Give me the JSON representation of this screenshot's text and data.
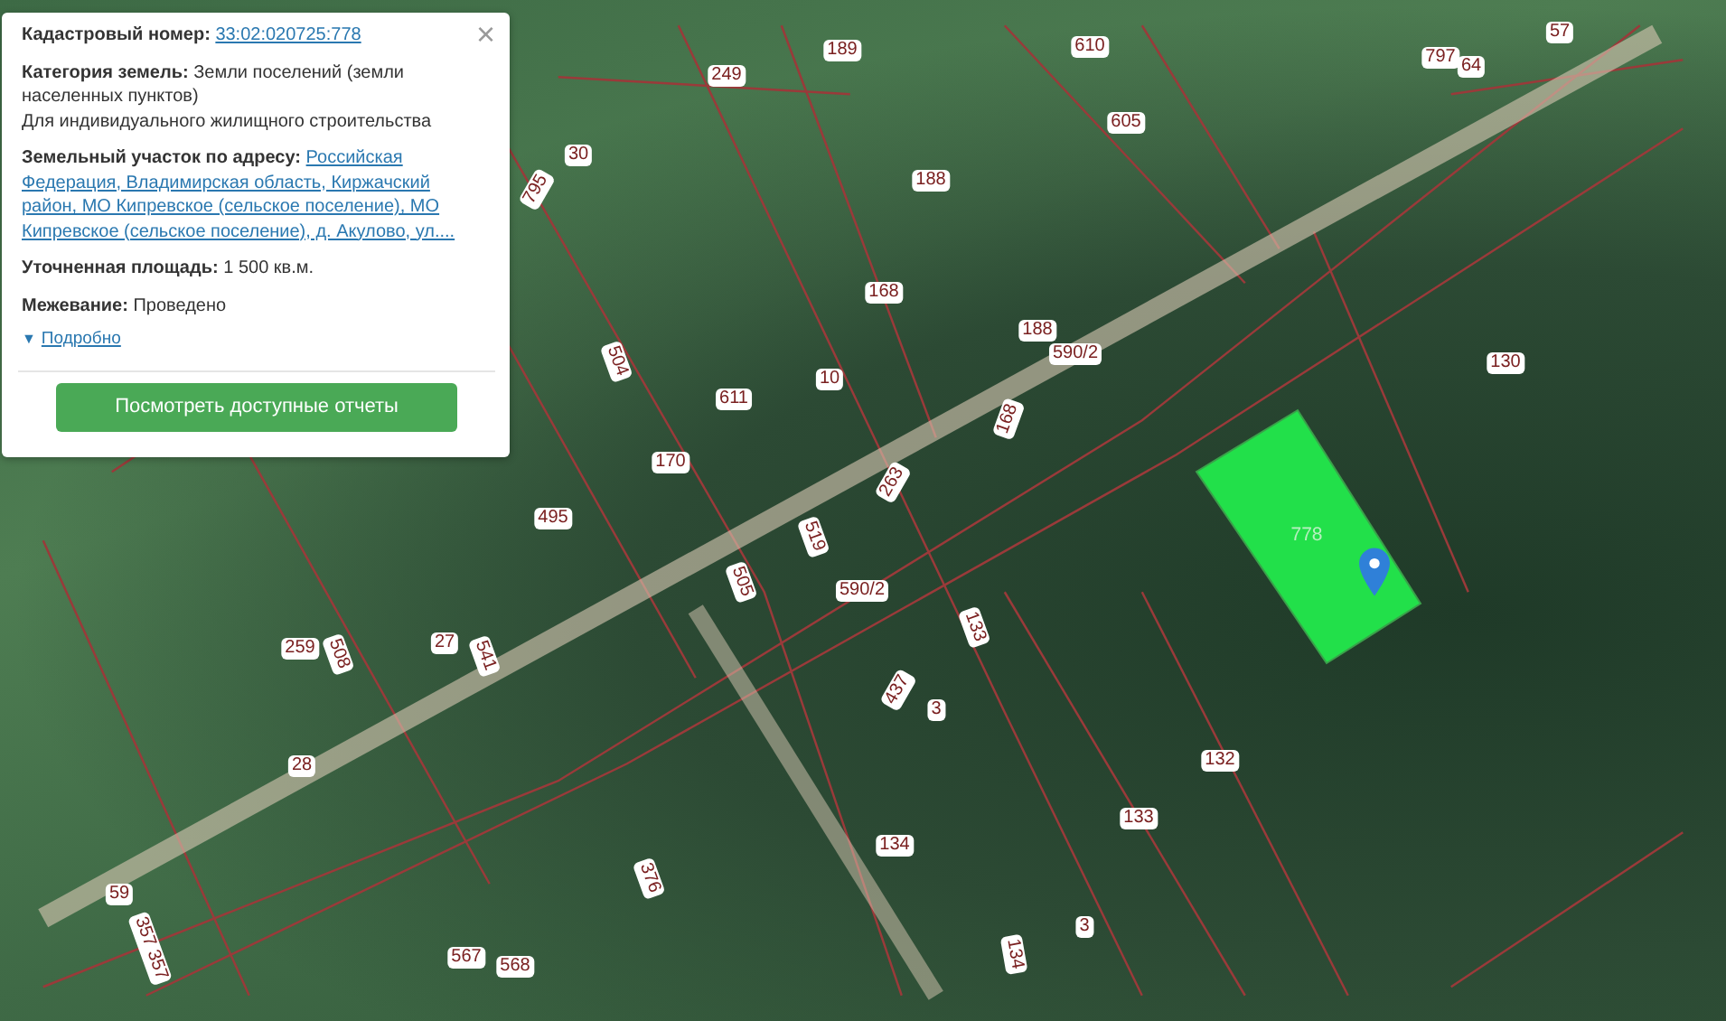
{
  "map": {
    "parcel_labels": [
      "249",
      "189",
      "610",
      "57",
      "797",
      "64",
      "605",
      "30",
      "795",
      "188",
      "168",
      "188",
      "590/2",
      "130",
      "504",
      "611",
      "10",
      "168",
      "263",
      "170",
      "778",
      "495",
      "519",
      "505",
      "590/2",
      "259",
      "508",
      "27",
      "541",
      "133",
      "437",
      "3",
      "28",
      "132",
      "134",
      "133",
      "376",
      "59",
      "357 357",
      "3",
      "134",
      "567",
      "568"
    ]
  },
  "popup": {
    "close": "×",
    "fields": [
      {
        "kind": "link",
        "label": "Кадастровый номер:",
        "value": "33:02:020725:778"
      },
      {
        "kind": "text",
        "label": "Категория земель:",
        "value": "Земли поселений (земли населенных пунктов)",
        "note": "Для индивидуального жилищного строительства"
      },
      {
        "kind": "address",
        "label": "Земельный участок по адресу:",
        "value": "Российская Федерация, Владимирская область, Киржачский район, МО Кипревское (сельское поселение), МО Кипревское (сельское поселение), д. Акулово, ул...."
      },
      {
        "kind": "text",
        "label": "Уточненная площадь:",
        "value": "1 500 кв.м."
      },
      {
        "kind": "text",
        "label": "Межевание:",
        "value": "Проведено"
      }
    ],
    "details": {
      "arrow": "▼",
      "label": "Подробно",
      "expanded": false
    },
    "button": "Посмотреть доступные отчеты"
  }
}
